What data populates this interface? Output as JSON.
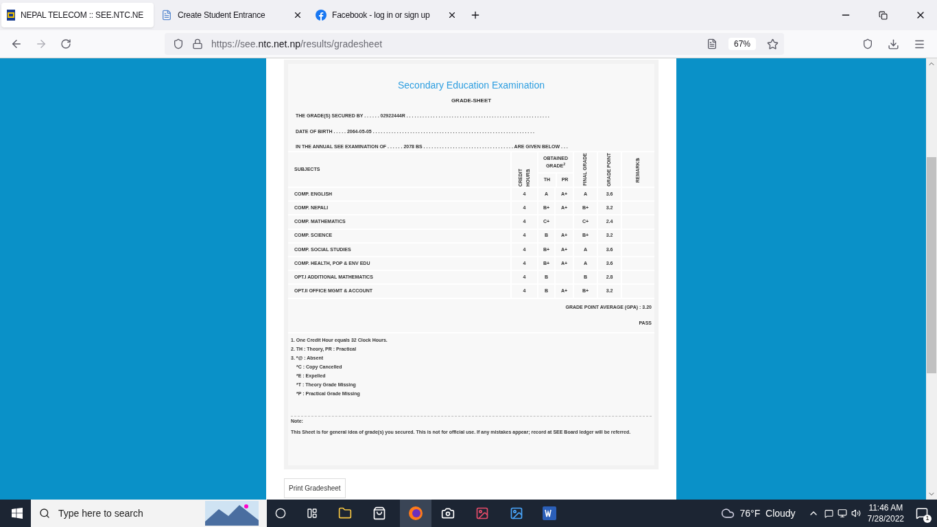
{
  "browser": {
    "tabs": [
      {
        "title": "NEPAL TELECOM :: SEE.NTC.NE",
        "kind": "logo",
        "selected": true
      },
      {
        "title": "Create Student Entrance",
        "kind": "document",
        "selected": false
      },
      {
        "title": "Facebook - log in or sign up",
        "kind": "facebook",
        "selected": false
      }
    ],
    "address": {
      "prefix": "https://see.",
      "domain": "ntc.net.np",
      "path": "/results/gradesheet"
    },
    "zoom": "67%"
  },
  "sheet": {
    "title": "Secondary Education Examination",
    "subtitle": "GRADE-SHEET",
    "info_lines": [
      {
        "label": "THE GRADE(S) SECURED BY . . . . . .",
        "value": "02922444R",
        "tail": ". . . . . . . . . . . . . . . . . . . . . . . . . . . . . . . . . . . . . . . . . . . . . . . . . . . . . ."
      },
      {
        "label": "DATE OF BIRTH . . . . .",
        "value": "2064-05-05",
        "tail": ". . . . . . . . . . . . . . . . . . . . . . . . . . . . . . . . . . . . . . . . . . . . . . . . . . . . . . . . . . . . ."
      },
      {
        "label": "IN THE ANNUAL SEE EXAMINATION OF . . . . . .",
        "value": "2078 BS",
        "tail": ". . . . . . . . . . . . . . . . . . . . . . . . . . . . . . . . . . ARE GIVEN BELOW . . ."
      }
    ],
    "columns": {
      "subjects": "SUBJECTS",
      "credit": "CREDIT HOURS$^{1}$",
      "obtained": "OBTAINED GRADE$^{2}$",
      "th": "TH",
      "pr": "PR",
      "final": "FINAL GRADE",
      "point": "GRADE POINT",
      "remarks": "REMARKS$^{3}$"
    },
    "rows": [
      {
        "subject": "COMP. ENGLISH",
        "credit": "4",
        "th": "A",
        "pr": "A+",
        "final": "A",
        "point": "3.6"
      },
      {
        "subject": "COMP. NEPALI",
        "credit": "4",
        "th": "B+",
        "pr": "A+",
        "final": "B+",
        "point": "3.2"
      },
      {
        "subject": "COMP. MATHEMATICS",
        "credit": "4",
        "th": "C+",
        "pr": "",
        "final": "C+",
        "point": "2.4"
      },
      {
        "subject": "COMP. SCIENCE",
        "credit": "4",
        "th": "B",
        "pr": "A+",
        "final": "B+",
        "point": "3.2"
      },
      {
        "subject": "COMP. SOCIAL STUDIES",
        "credit": "4",
        "th": "B+",
        "pr": "A+",
        "final": "A",
        "point": "3.6"
      },
      {
        "subject": "COMP. HEALTH, POP & ENV EDU",
        "credit": "4",
        "th": "B+",
        "pr": "A+",
        "final": "A",
        "point": "3.6"
      },
      {
        "subject": "OPT.I ADDITIONAL MATHEMATICS",
        "credit": "4",
        "th": "B",
        "pr": "",
        "final": "B",
        "point": "2.8"
      },
      {
        "subject": "OPT.II OFFICE MGMT & ACCOUNT",
        "credit": "4",
        "th": "B",
        "pr": "A+",
        "final": "B+",
        "point": "3.2"
      }
    ],
    "gpa": "GRADE POINT AVERAGE (GPA) : 3.20",
    "result": "PASS",
    "footnotes": [
      "1. One Credit Hour equals 32 Clock Hours.",
      "2. TH : Theory, PR : Practical",
      "3. *@ : Absent",
      "*C : Copy Cancelled",
      "*E : Expelled",
      "*T : Theory Grade Missing",
      "*P : Practical Grade Missing"
    ],
    "note_label": "Note:",
    "note": "This Sheet is for general idea of grade(s) you secured. This is not for official use. If any mistakes appear; record at SEE Board ledger will be referred.",
    "print_button": "Print Gradesheet"
  },
  "taskbar": {
    "search_placeholder": "Type here to search",
    "weather": "76°F  Cloudy",
    "time": "11:46 AM",
    "date": "7/28/2022",
    "notifications": "1"
  }
}
